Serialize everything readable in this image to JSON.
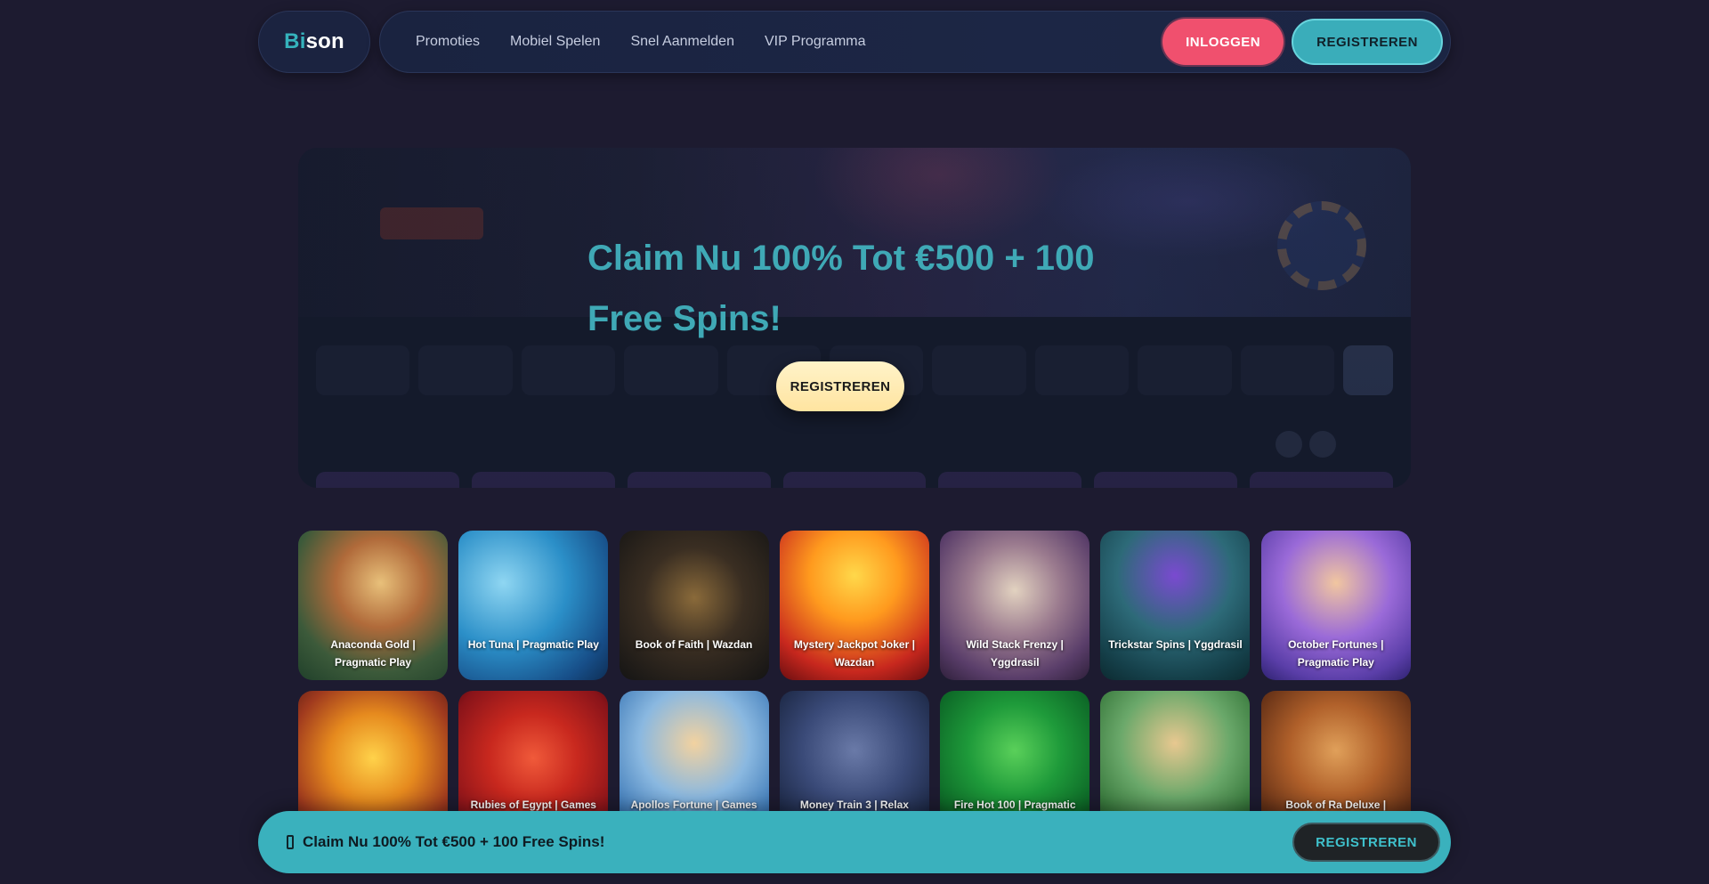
{
  "brand": {
    "logo_part1": "Bi",
    "logo_part2": "son"
  },
  "nav": {
    "links": [
      "Promoties",
      "Mobiel Spelen",
      "Snel Aanmelden",
      "VIP Programma"
    ],
    "login_label": "INLOGGEN",
    "register_label": "REGISTREREN"
  },
  "hero": {
    "headline": "Claim Nu 100% Tot €500 + 100 Free Spins!",
    "cta_label": "REGISTREREN"
  },
  "games": [
    {
      "title": "Anaconda Gold | Pragmatic Play",
      "icon": "anaconda-gold-art"
    },
    {
      "title": "Hot Tuna | Pragmatic Play",
      "icon": "hot-tuna-art"
    },
    {
      "title": "Book of Faith | Wazdan",
      "icon": "book-of-faith-art"
    },
    {
      "title": "Mystery Jackpot Joker | Wazdan",
      "icon": "mystery-jackpot-joker-art"
    },
    {
      "title": "Wild Stack Frenzy | Yggdrasil",
      "icon": "wild-stack-frenzy-art"
    },
    {
      "title": "Trickstar Spins | Yggdrasil",
      "icon": "trickstar-spins-art"
    },
    {
      "title": "October Fortunes | Pragmatic Play",
      "icon": "october-fortunes-art"
    },
    {
      "title": "",
      "icon": "lucky-piggies-art"
    },
    {
      "title": "Rubies of Egypt | Games",
      "icon": "rubies-of-egypt-art"
    },
    {
      "title": "Apollos Fortune | Games",
      "icon": "apollos-fortune-art"
    },
    {
      "title": "Money Train 3 | Relax",
      "icon": "money-train-3-art"
    },
    {
      "title": "Fire Hot 100 | Pragmatic",
      "icon": "fire-hot-100-art"
    },
    {
      "title": "",
      "icon": "hit-bank-art"
    },
    {
      "title": "Book of Ra Deluxe |",
      "icon": "book-of-ra-deluxe-art"
    }
  ],
  "bottom_banner": {
    "icon": "gift-icon",
    "text": "Claim Nu 100% Tot €500 + 100 Free Spins!",
    "cta_label": "REGISTREREN"
  },
  "colors": {
    "background": "#1d1b30",
    "accent_teal": "#3ab1bd",
    "login_pink": "#f0506e",
    "cta_cream": "#ffe9ad"
  }
}
